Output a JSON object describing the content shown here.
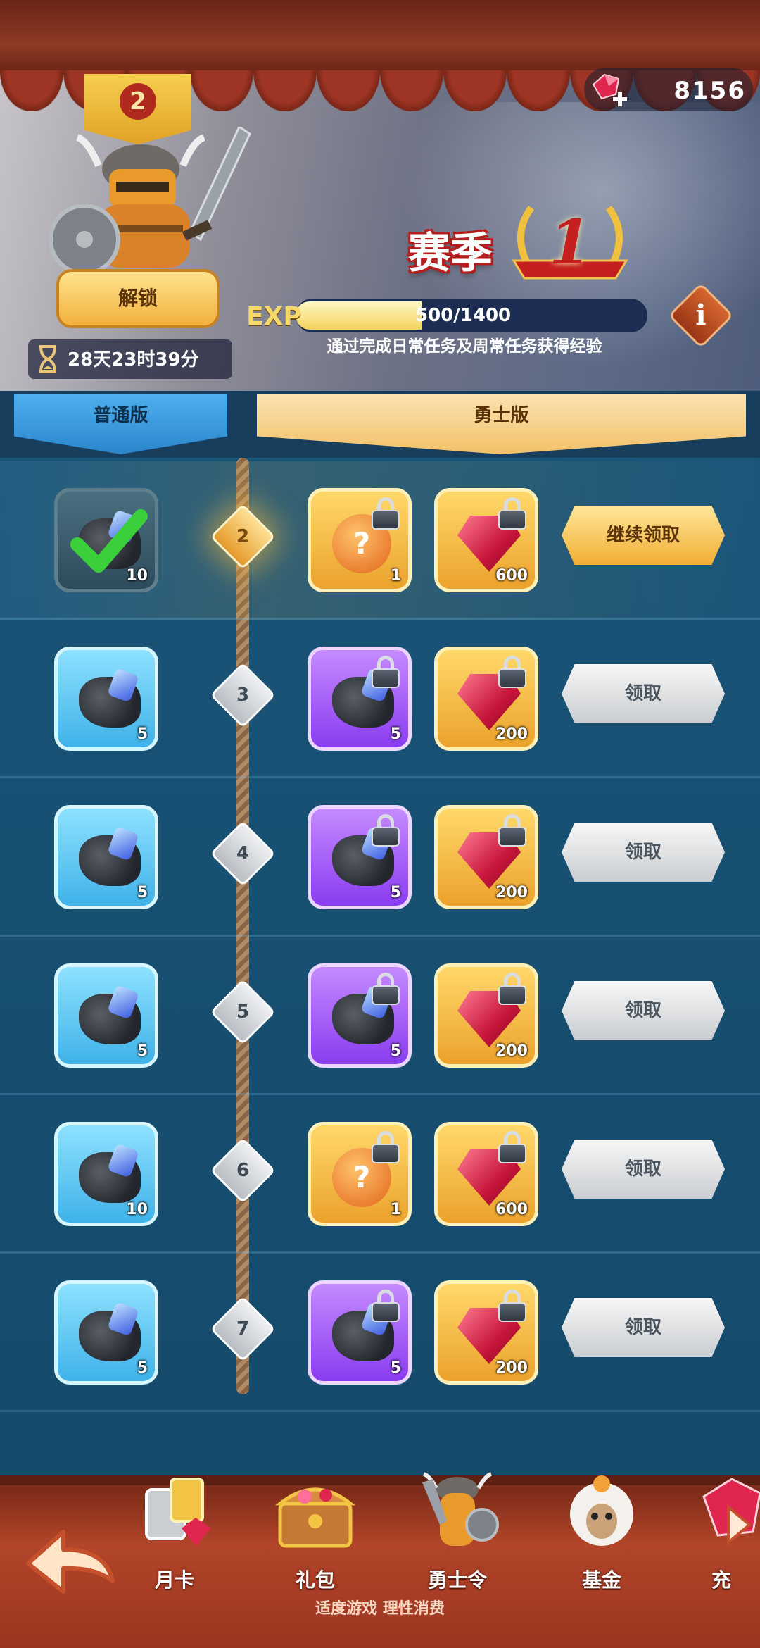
{
  "header": {
    "gem_count": "8156",
    "level_badge": "2",
    "unlock_label": "解锁",
    "timer": "28天23时39分",
    "season_title": "赛季",
    "season_number": "1",
    "exp_label": "EXP",
    "exp_text": "500/1400",
    "exp_progress": 0.357,
    "exp_description": "通过完成日常任务及周常任务获得经验",
    "info_label": "i"
  },
  "tabs": {
    "normal": "普通版",
    "warrior": "勇士版"
  },
  "rows": [
    {
      "level": "2",
      "free_qty": "10",
      "premium1_type": "mystery",
      "premium1_qty": "1",
      "premium2_qty": "600",
      "button": "继续领取"
    },
    {
      "level": "3",
      "free_qty": "5",
      "premium1_type": "ore-purple",
      "premium1_qty": "5",
      "premium2_qty": "200",
      "button": "领取"
    },
    {
      "level": "4",
      "free_qty": "5",
      "premium1_type": "ore-purple",
      "premium1_qty": "5",
      "premium2_qty": "200",
      "button": "领取"
    },
    {
      "level": "5",
      "free_qty": "5",
      "premium1_type": "ore-purple",
      "premium1_qty": "5",
      "premium2_qty": "200",
      "button": "领取"
    },
    {
      "level": "6",
      "free_qty": "10",
      "premium1_type": "mystery",
      "premium1_qty": "1",
      "premium2_qty": "600",
      "button": "领取"
    },
    {
      "level": "7",
      "free_qty": "5",
      "premium1_type": "ore-purple",
      "premium1_qty": "5",
      "premium2_qty": "200",
      "button": "领取"
    }
  ],
  "nav": {
    "items": [
      "月卡",
      "礼包",
      "勇士令",
      "基金",
      "充"
    ],
    "slogan": "适度游戏 理性消费"
  },
  "icons": {
    "gem": "ruby-gem-plus-icon",
    "back": "back-arrow-icon",
    "hourglass": "hourglass-icon",
    "lock": "lock-icon",
    "check": "checkmark-icon"
  },
  "colors": {
    "accent_gold": "#f1ae33",
    "tab_blue": "#2b86cc",
    "gem_red": "#c6143a",
    "purple_tile": "#8a3cf0"
  }
}
